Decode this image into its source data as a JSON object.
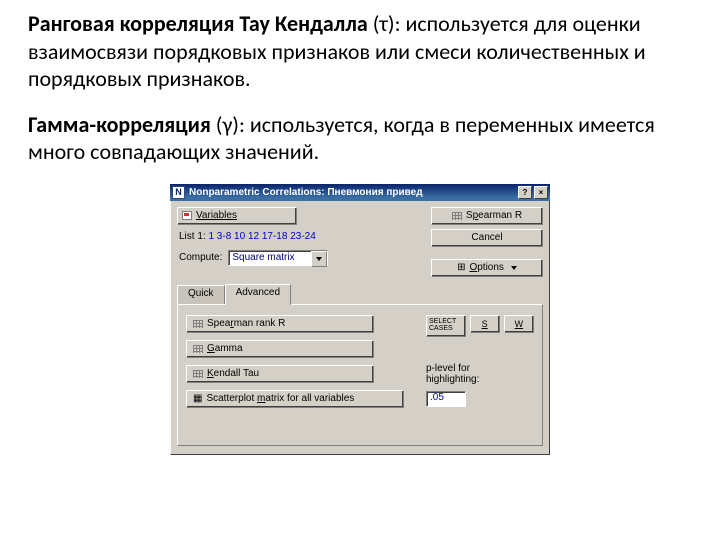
{
  "para1": {
    "bold": "Ранговая корреляция Тау Кендалла",
    "rest": " (τ): используется для оценки взаимосвязи порядковых признаков или смеси количественных и порядковых признаков."
  },
  "para2": {
    "bold": "Гамма-корреляция",
    "rest": " (γ): используется, когда в переменных имеется много совпадающих значений."
  },
  "dialog": {
    "title": "Nonparametric Correlations: Пневмония привед",
    "help": "?",
    "close": "×",
    "variables": "Variables",
    "spearman_btn": "Spearman R",
    "spearman_u": "R",
    "cancel": "Cancel",
    "list_label": "List 1:",
    "list_values": "1 3-8 10 12 17-18 23-24",
    "options": "Options",
    "options_u": "O",
    "compute_label": "Compute:",
    "compute_value": "Square matrix",
    "tabs": {
      "quick": "Quick",
      "advanced": "Advanced"
    },
    "buttons": {
      "spearman_rank": "Spearman rank R",
      "gamma": "Gamma",
      "kendall": "Kendall Tau",
      "scatter": "Scatterplot matrix for all variables"
    },
    "select_cases": "SELECT CASES",
    "s": "S",
    "w": "W",
    "plevel_label1": "p-level for",
    "plevel_label2": "highlighting:",
    "plevel_value": ".05"
  }
}
